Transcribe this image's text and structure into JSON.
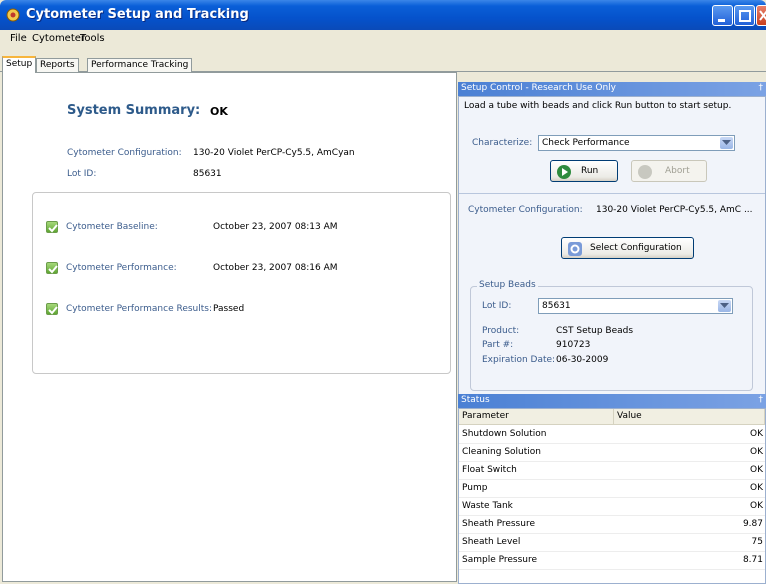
{
  "window": {
    "title": "Cytometer Setup and Tracking"
  },
  "menu": [
    {
      "label": "File"
    },
    {
      "label": "Cytometer"
    },
    {
      "label": "Tools"
    }
  ],
  "tabs": [
    {
      "label": "Setup"
    },
    {
      "label": "Reports"
    },
    {
      "label": "Performance Tracking"
    }
  ],
  "summary": {
    "title": "System Summary:",
    "status": "OK",
    "config_label": "Cytometer Configuration:",
    "config_value": "130-20 Violet PerCP-Cy5.5, AmCyan",
    "lot_label": "Lot ID:",
    "lot_value": "85631",
    "checks": [
      {
        "label": "Cytometer Baseline:",
        "value": "October 23, 2007 08:13 AM"
      },
      {
        "label": "Cytometer Performance:",
        "value": "October 23, 2007 08:16 AM"
      },
      {
        "label": "Cytometer Performance Results:",
        "value": "Passed"
      }
    ]
  },
  "setup_control": {
    "header": "Setup Control - Research Use Only",
    "instructions": "Load a tube with beads and click Run button to start setup.",
    "characterize_label": "Characterize:",
    "characterize_value": "Check Performance",
    "run_label": "Run",
    "abort_label": "Abort",
    "config_label": "Cytometer Configuration:",
    "config_value": "130-20 Violet PerCP-Cy5.5, AmC ...",
    "select_config_label": "Select Configuration",
    "beads": {
      "legend": "Setup Beads",
      "lot_label": "Lot ID:",
      "lot_value": "85631",
      "product_label": "Product:",
      "product_value": "CST Setup Beads",
      "part_label": "Part #:",
      "part_value": "910723",
      "expiration_label": "Expiration Date:",
      "expiration_value": "06-30-2009"
    }
  },
  "status": {
    "header": "Status",
    "columns": [
      "Parameter",
      "Value"
    ],
    "rows": [
      {
        "parameter": "Shutdown Solution",
        "value": "OK"
      },
      {
        "parameter": "Cleaning Solution",
        "value": "OK"
      },
      {
        "parameter": "Float Switch",
        "value": "OK"
      },
      {
        "parameter": "Pump",
        "value": "OK"
      },
      {
        "parameter": "Waste Tank",
        "value": "OK"
      },
      {
        "parameter": "Sheath Pressure",
        "value": "9.87"
      },
      {
        "parameter": "Sheath Level",
        "value": "75"
      },
      {
        "parameter": "Sample Pressure",
        "value": "8.71"
      }
    ]
  },
  "icons": {
    "app": "cytometer-app-icon",
    "minimize": "minimize-icon",
    "maximize": "maximize-icon",
    "close": "close-icon",
    "check": "check-icon",
    "run": "run-icon",
    "abort": "abort-icon",
    "gear": "gear-icon",
    "pin": "pin-icon",
    "dropdown": "chevron-down-icon"
  }
}
